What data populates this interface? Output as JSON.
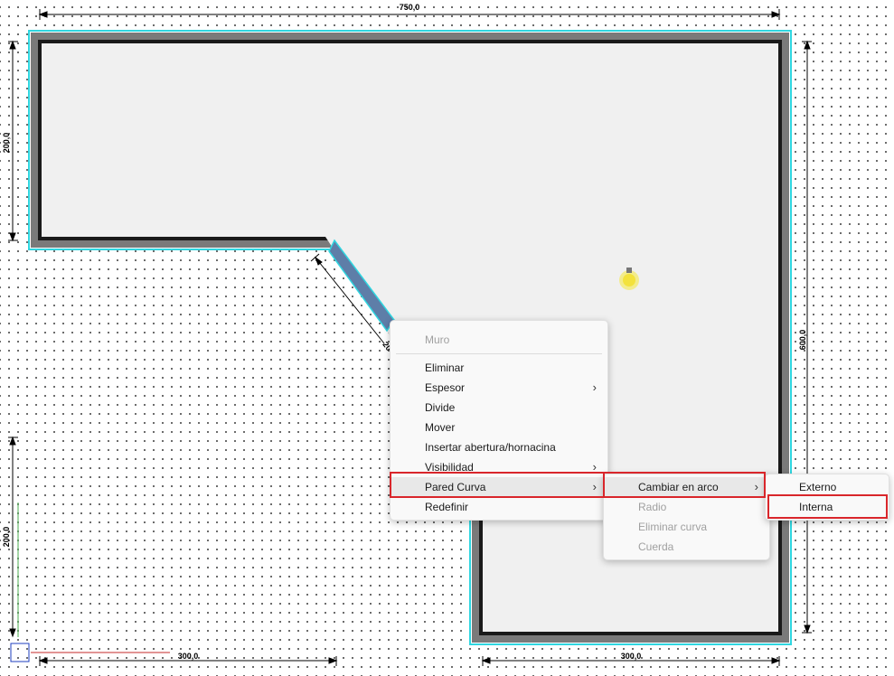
{
  "dimensions": {
    "top": "750,0",
    "left_top": "200,0",
    "right": "600,0",
    "left_bottom": "200,0",
    "bottom_left": "300,0",
    "bottom_right": "300,0",
    "diagonal": "20"
  },
  "context_menu": {
    "header": "Muro",
    "items": [
      "Eliminar",
      "Espesor",
      "Divide",
      "Mover",
      "Insertar abertura/hornacina",
      "Visibilidad",
      "Pared Curva",
      "Redefinir"
    ]
  },
  "submenu": {
    "items": [
      "Cambiar en arco",
      "Radio",
      "Eliminar curva",
      "Cuerda"
    ]
  },
  "submenu2": {
    "items": [
      "Externo",
      "Interna"
    ]
  },
  "colors": {
    "wall_outer": "#7a7a7a",
    "wall_inner": "#1a1a1a",
    "selected_wall": "#5e7ea8",
    "outline": "#2fd6e0",
    "highlight": "#d9262b"
  },
  "icons": {
    "light": "lightbulb-icon",
    "submenu_arrow": "chevron-right-icon"
  }
}
